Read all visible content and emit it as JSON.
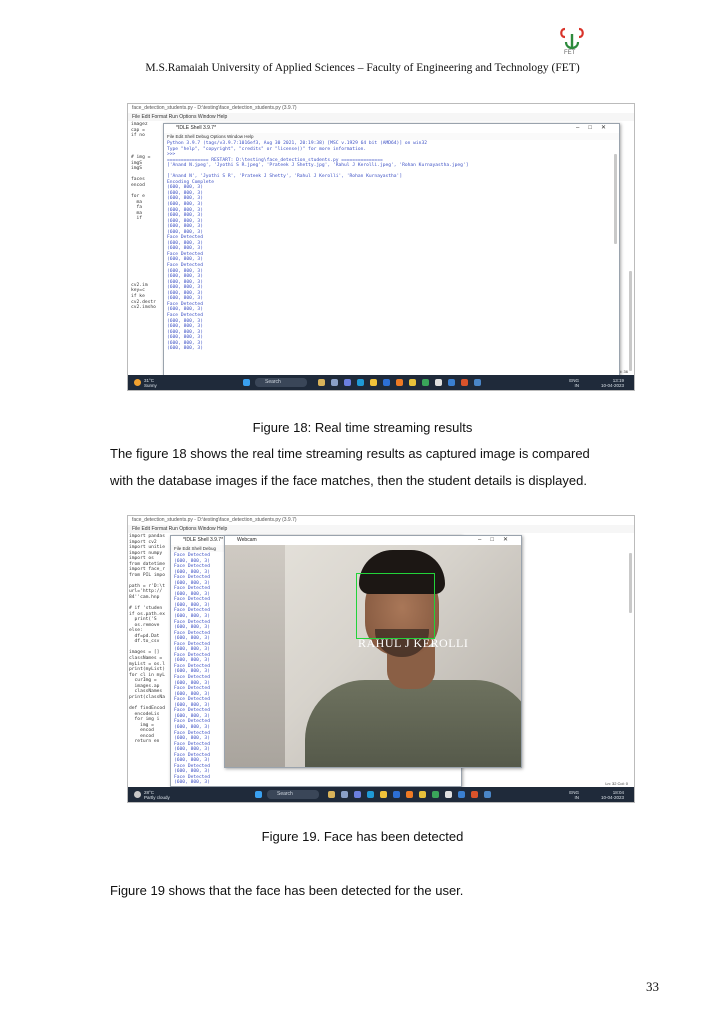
{
  "header": {
    "logo_text": "FET",
    "title": "M.S.Ramaiah University of Applied Sciences – Faculty of Engineering and Technology (FET)"
  },
  "figure18": {
    "editor_title": "face_detection_students.py - D:\\testing\\face_detection_students.py (3.9.7)",
    "menu": "File   Edit   Format   Run   Options   Window   Help",
    "shell_title": "*IDLE Shell 3.9.7*",
    "shell_menu": "File   Edit   Shell   Debug   Options   Window   Help",
    "shell_lines": [
      "Python 3.9.7 (tags/v3.9.7:1016ef3, Aug 30 2021, 20:19:38) [MSC v.1929 64 bit (AMD64)] on win32",
      "Type \"help\", \"copyright\", \"credits\" or \"license()\" for more information.",
      ">>>",
      "=============== RESTART: D:\\testing\\face_detection_students.py ===============",
      "['Anand N.jpeg', 'Jyothi S R.jpeg', 'Prateek J Shetty.jpg', 'Rahul J Kerolli.jpeg', 'Rohan Kurnayastha.jpeg']",
      "",
      "['Anand N', 'Jyothi S R', 'Prateek J Shetty', 'Rahul J Kerolli', 'Rohan Kurnayastha']",
      "Encoding Complete",
      "(600, 800, 3)",
      "(600, 800, 3)",
      "(600, 800, 3)",
      "(600, 800, 3)",
      "(600, 800, 3)",
      "(600, 800, 3)",
      "(600, 800, 3)",
      "(600, 800, 3)",
      "(600, 800, 3)",
      "Face Detected",
      "(600, 800, 3)",
      "(600, 800, 3)",
      "Face Detected",
      "(600, 800, 3)",
      "Face Detected",
      "(600, 800, 3)",
      "(600, 800, 3)",
      "(600, 800, 3)",
      "(600, 800, 3)",
      "(600, 800, 3)",
      "(600, 800, 3)",
      "Face Detected",
      "(600, 800, 3)",
      "Face Detected",
      "(600, 800, 3)",
      "(600, 800, 3)",
      "(600, 800, 3)",
      "(600, 800, 3)",
      "(600, 800, 3)",
      "(600, 800, 3)"
    ],
    "code_lines": [
      "imagez",
      "cap =",
      "if no",
      "",
      "",
      "",
      "# img =",
      "imgS",
      "imgS",
      "",
      "faces",
      "encod",
      "",
      "for e",
      "  ma",
      "  fa",
      "  ma",
      "  if",
      "",
      "",
      "",
      "",
      "",
      "",
      "",
      "",
      "",
      "",
      "",
      "cv2.im",
      "key=c",
      "if ke",
      "cv2.destr",
      "cv2.imsho"
    ],
    "status": "Ln: 36   Col: 36",
    "weather_temp": "31°C",
    "weather_desc": "Sunny",
    "search_label": "Search",
    "lang": "ENG\nIN",
    "clock": "13:19\n10-04-2023"
  },
  "caption18": "Figure 18: Real time streaming results",
  "para1": "The figure 18 shows the real time streaming results as captured image is compared",
  "para2": "with the database images if the face matches, then the student details is displayed.",
  "figure19": {
    "editor_title": "face_detection_students.py - D:\\testing\\face_detection_students.py (3.9.7)",
    "menu": "File   Edit   Format   Run   Options   Window   Help",
    "shell_title": "*IDLE Shell 3.9.7*",
    "shell_menu": "File   Edit   Shell   Debug",
    "webcam_title": "Webcam",
    "face_label": "RAHUL J KEROLLI",
    "shell_lines": [
      "Face Detected",
      "(600, 800, 3)",
      "Face Detected",
      "(600, 800, 3)",
      "Face Detected",
      "(600, 800, 3)",
      "Face Detected",
      "(600, 800, 3)",
      "Face Detected",
      "(600, 800, 3)",
      "Face Detected",
      "(600, 800, 3)",
      "Face Detected",
      "(600, 800, 3)",
      "Face Detected",
      "(600, 800, 3)",
      "Face Detected",
      "(600, 800, 3)",
      "Face Detected",
      "(600, 800, 3)",
      "Face Detected",
      "(600, 800, 3)",
      "Face Detected",
      "(600, 800, 3)",
      "Face Detected",
      "(600, 800, 3)",
      "Face Detected",
      "(600, 800, 3)",
      "Face Detected",
      "(600, 800, 3)",
      "Face Detected",
      "(600, 800, 3)",
      "Face Detected",
      "(600, 800, 3)",
      "Face Detected",
      "(600, 800, 3)",
      "Face Detected",
      "(600, 800, 3)",
      "Face Detected",
      "(600, 800, 3)",
      "Face Detected",
      "(600, 800, 3)"
    ],
    "code_lines": [
      "import pandas",
      "import cv2",
      "import unitie",
      "import numpy",
      "import os",
      "from datetime",
      "import face_r",
      "from PIL impo",
      "",
      "path = r'D:\\t",
      "url='http://",
      "84''cam.hnp",
      "",
      "# if 'studen",
      "if os.path.ex",
      "  print('S",
      "  os.remove",
      "else:",
      "  df=pd.Dat",
      "  df.to_csv",
      "",
      "images = []",
      "classNames =",
      "myList = os.l",
      "print(myList)",
      "for cl in myL",
      "  curImg =",
      "  images.ap",
      "  classNames",
      "print(classNa",
      "",
      "def findEncod",
      "  encodeLis",
      "  for img i",
      "    img =",
      "    encod",
      "    encod",
      "  return en"
    ],
    "status": "Ln: 32   Col: 0",
    "weather_temp": "28°C",
    "weather_desc": "Partly cloudy",
    "search_label": "Search",
    "lang": "ENG\nIN",
    "clock": "18:04\n10-04-2023"
  },
  "caption19": "Figure 19. Face has been detected",
  "para3": "Figure 19 shows that the face has been detected for the user.",
  "page_number": "33"
}
